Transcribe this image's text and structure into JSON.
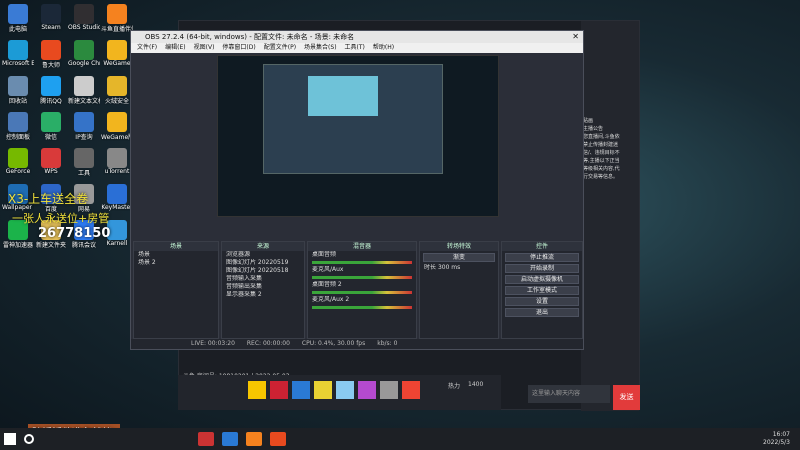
{
  "desktop_icons": [
    {
      "label": "此电脑",
      "color": "#3a7bd5"
    },
    {
      "label": "Steam",
      "color": "#1b2838"
    },
    {
      "label": "OBS Studio",
      "color": "#302e31"
    },
    {
      "label": "斗鱼直播伴侣",
      "color": "#f5821f"
    },
    {
      "label": "Microsoft Edge",
      "color": "#1c9bd6"
    },
    {
      "label": "鲁大师",
      "color": "#e84a1f"
    },
    {
      "label": "Google Chrome",
      "color": "#2b8a3e"
    },
    {
      "label": "WeGame",
      "color": "#f2b51e"
    },
    {
      "label": "回收站",
      "color": "#6a8caf"
    },
    {
      "label": "腾讯QQ",
      "color": "#1ea0f0"
    },
    {
      "label": "新建文本文档",
      "color": "#ccc"
    },
    {
      "label": "火绒安全",
      "color": "#e5b62a"
    },
    {
      "label": "控制面板",
      "color": "#4a78b7"
    },
    {
      "label": "微信",
      "color": "#2aae67"
    },
    {
      "label": "IP查询",
      "color": "#3573c8"
    },
    {
      "label": "WeGame版",
      "color": "#f2b51e"
    },
    {
      "label": "GeForce",
      "color": "#76b900"
    },
    {
      "label": "WPS",
      "color": "#d93a3a"
    },
    {
      "label": "工具",
      "color": "#666"
    },
    {
      "label": "uTorrent",
      "color": "#888"
    },
    {
      "label": "Wallpaper Engine",
      "color": "#1e6cb3"
    },
    {
      "label": "百度",
      "color": "#2d66c8"
    },
    {
      "label": "网易",
      "color": "#999"
    },
    {
      "label": "KeyMaster",
      "color": "#2a6fd6"
    },
    {
      "label": "雷神加速器",
      "color": "#1bb34a"
    },
    {
      "label": "新建文件夹",
      "color": "#e7c25b"
    },
    {
      "label": "腾讯会议",
      "color": "#2e7cf6"
    },
    {
      "label": "Karnell",
      "color": "#3396db"
    }
  ],
  "overlay": {
    "line1": "X3-上车送全卷",
    "line2": "一张人永送位+房管",
    "fan_id": "26778150",
    "notice": "跨播插件准备就绪!"
  },
  "obs": {
    "title": "OBS 27.2.4 (64-bit, windows) - 配置文件: 未命名 - 场景: 未命名",
    "menu": [
      "文件(F)",
      "编辑(E)",
      "视图(V)",
      "停靠窗口(D)",
      "配置文件(P)",
      "场景集合(S)",
      "工具(T)",
      "帮助(H)"
    ],
    "docks": {
      "scenes": {
        "title": "场景",
        "items": [
          "场景",
          "场景 2"
        ]
      },
      "sources": {
        "title": "来源",
        "items": [
          "浏览器源",
          "图像幻灯片 20220519",
          "图像幻灯片 20220518",
          "音频输入采集",
          "音频输出采集",
          "显示器采集 2"
        ]
      },
      "mixer": {
        "title": "混音器",
        "tracks": [
          "桌面音频",
          "麦克风/Aux",
          "桌面音频 2",
          "麦克风/Aux 2"
        ]
      },
      "transitions": {
        "title": "转场特效",
        "type": "渐变",
        "duration_label": "时长",
        "duration": "300 ms"
      },
      "controls": {
        "title": "控件",
        "buttons": [
          "停止推流",
          "开始录制",
          "启动虚拟摄像机",
          "工作室模式",
          "设置",
          "退出"
        ]
      }
    },
    "status": [
      "LIVE: 00:03:20",
      "REC: 00:00:00",
      "CPU: 0.4%, 30.00 fps",
      "kb/s: 0"
    ]
  },
  "douyu": {
    "room_line": "斗鱼 房间号: 10810201 | 2022.05.03",
    "hot_label": "热力",
    "hot_value": "1400",
    "chat_placeholder": "这里输入聊天内容",
    "send_label": "发送",
    "side_texts": [
      "贴画",
      "主播公告",
      "您直播间,斗鱼依",
      "禁止传播封建迷",
      "信/、违规目标不",
      "等,主播以下正当",
      "等级相关内容,代",
      "行交易等信息。"
    ]
  },
  "taskbar": {
    "time": "16:07",
    "date": "2022/5/3"
  }
}
